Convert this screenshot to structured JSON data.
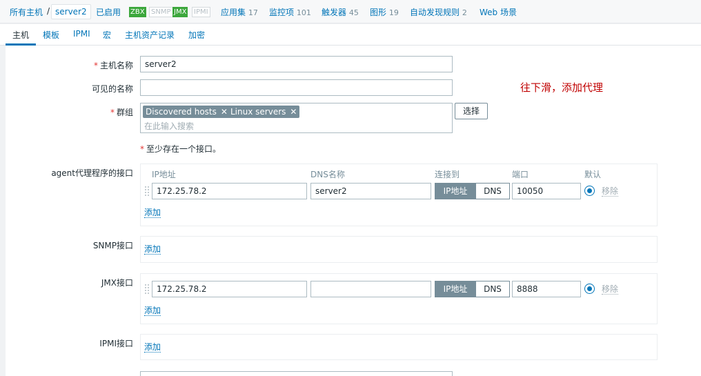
{
  "topnav": {
    "all_hosts": "所有主机",
    "separator": "/",
    "current_host": "server2",
    "status": "已启用",
    "badges": [
      {
        "label": "ZBX",
        "active": true
      },
      {
        "label": "SNMP",
        "active": false
      },
      {
        "label": "JMX",
        "active": true
      },
      {
        "label": "IPMI",
        "active": false
      }
    ],
    "links": [
      {
        "label": "应用集",
        "count": "17"
      },
      {
        "label": "监控项",
        "count": "101"
      },
      {
        "label": "触发器",
        "count": "45"
      },
      {
        "label": "图形",
        "count": "19"
      },
      {
        "label": "自动发现规则",
        "count": "2"
      },
      {
        "label": "Web 场景",
        "count": ""
      }
    ]
  },
  "tabs": [
    "主机",
    "模板",
    "IPMI",
    "宏",
    "主机资产记录",
    "加密"
  ],
  "form": {
    "host_name_label": "主机名称",
    "host_name_value": "server2",
    "visible_name_label": "可见的名称",
    "visible_name_value": "",
    "groups_label": "群组",
    "groups": [
      "Discovered hosts",
      "Linux servers"
    ],
    "groups_placeholder": "在此输入搜索",
    "select_button": "选择",
    "interface_note": "至少存在一个接口。",
    "annotation": "往下滑，添加代理"
  },
  "interfaces": {
    "col_ip": "IP地址",
    "col_dns": "DNS名称",
    "col_connect": "连接到",
    "col_port": "端口",
    "col_default": "默认",
    "connect_ip": "IP地址",
    "connect_dns": "DNS",
    "remove": "移除",
    "add": "添加",
    "agent": {
      "label": "agent代理程序的接口",
      "ip": "172.25.78.2",
      "dns": "server2",
      "port": "10050"
    },
    "snmp": {
      "label": "SNMP接口"
    },
    "jmx": {
      "label": "JMX接口",
      "ip": "172.25.78.2",
      "dns": "",
      "port": "8888"
    },
    "ipmi": {
      "label": "IPMI接口"
    }
  },
  "colors": {
    "accent": "#0275b8",
    "enabled": "#3ca73c",
    "required": "#e33734",
    "annotation": "#c00000"
  }
}
